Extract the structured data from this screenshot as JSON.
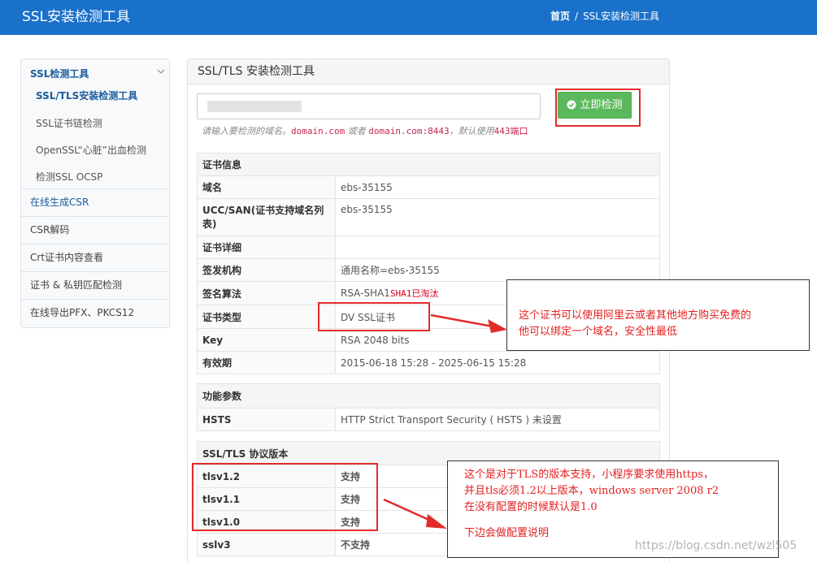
{
  "header": {
    "brand": "SSL安装检测工具",
    "crumb_home": "首页",
    "crumb_sep": "/",
    "crumb_current": "SSL安装检测工具"
  },
  "sidebar": {
    "group_title": "SSL检测工具",
    "group_subitems": [
      "SSL/TLS安装检测工具",
      "SSL证书链检测",
      "OpenSSL“心脏”出血检测",
      "检测SSL OCSP"
    ],
    "items": [
      "在线生成CSR",
      "CSR解码",
      "Crt证书内容查看",
      "证书 & 私钥匹配检测",
      "在线导出PFX、PKCS12"
    ]
  },
  "panel": {
    "title": "SSL/TLS 安装检测工具",
    "input_value": "",
    "check_button": "立即检测",
    "hint_pre": "请输入要检测的域名。",
    "hint_code1": "domain.com",
    "hint_mid": " 或者 ",
    "hint_code2": "domain.com:8443",
    "hint_post": "，默认使用",
    "hint_port": "443端口"
  },
  "cert_table": {
    "section": "证书信息",
    "rows": [
      {
        "key": "域名",
        "value": "ebs-35155"
      },
      {
        "key": "UCC/SAN(证书支持域名列表)",
        "value": "ebs-35155"
      },
      {
        "key": "证书详细",
        "value": ""
      },
      {
        "key": "签发机构",
        "value": "通用名称=ebs-35155"
      },
      {
        "key": "签名算法",
        "value": "RSA-SHA1",
        "note": "SHA1已淘汰"
      },
      {
        "key": "证书类型",
        "value": "DV SSL证书"
      },
      {
        "key": "Key",
        "value": "RSA 2048 bits"
      },
      {
        "key": "有效期",
        "value": "2015-06-18 15:28 - 2025-06-15 15:28"
      }
    ]
  },
  "feature_table": {
    "section": "功能参数",
    "rows": [
      {
        "key": "HSTS",
        "value": "HTTP Strict Transport Security ( HSTS ) 未设置"
      }
    ]
  },
  "proto_table": {
    "section": "SSL/TLS 协议版本",
    "rows": [
      {
        "key": "tlsv1.2",
        "value": "支持"
      },
      {
        "key": "tlsv1.1",
        "value": "支持"
      },
      {
        "key": "tlsv1.0",
        "value": "支持"
      },
      {
        "key": "sslv3",
        "value": "不支持"
      }
    ]
  },
  "annotations": {
    "cert_note_line1": "这个证书可以使用阿里云或者其他地方购买免费的",
    "cert_note_line2": "他可以绑定一个域名，安全性最低",
    "tls_note_line1": "这个是对于TLS的版本支持，小程序要求使用https，",
    "tls_note_line2": "并且tls必须1.2以上版本，windows server 2008 r2",
    "tls_note_line3": "在没有配置的时候默认是1.0",
    "tls_note_line4": "下边会做配置说明"
  },
  "watermark": "https://blog.csdn.net/wzl505",
  "colors": {
    "header_bg": "#1a71c9",
    "button_green": "#5cb85c",
    "annotation_red": "#e32020",
    "ok_green": "#2e8a2e",
    "link_blue": "#1a5c9c"
  },
  "icons": {
    "check_button_icon": "check-circle-icon",
    "group_chevron": "chevron-down-icon"
  }
}
